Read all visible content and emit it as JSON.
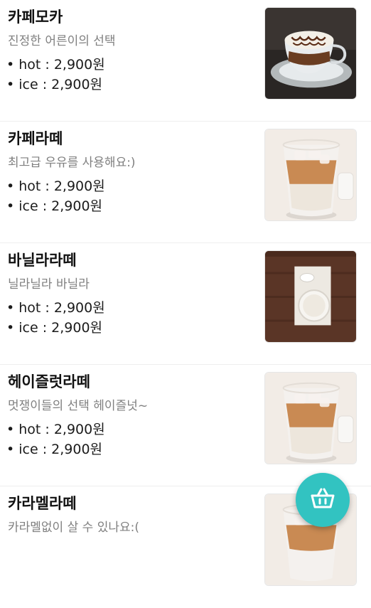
{
  "menu": {
    "items": [
      {
        "name": "카페모카",
        "description": "진정한 어른이의 선택",
        "hot_price": "• hot : 2,900원",
        "ice_price": "• ice : 2,900원",
        "image": "hot-mocha"
      },
      {
        "name": "카페라떼",
        "description": "최고급 우유를 사용해요:)",
        "hot_price": "• hot : 2,900원",
        "ice_price": "• ice : 2,900원",
        "image": "iced-latte"
      },
      {
        "name": "바닐라라떼",
        "description": "닐라닐라 바닐라",
        "hot_price": "• hot : 2,900원",
        "ice_price": "• ice : 2,900원",
        "image": "vanilla-latte-top"
      },
      {
        "name": "헤이즐럿라떼",
        "description": "멋쟁이들의 선택 헤이즐넛~",
        "hot_price": "• hot : 2,900원",
        "ice_price": "• ice : 2,900원",
        "image": "iced-latte"
      },
      {
        "name": "카라멜라떼",
        "description": "카라멜없이 살 수 있나요:(",
        "hot_price": "",
        "ice_price": "",
        "image": "iced-latte"
      }
    ]
  },
  "cart_button": {
    "icon": "basket-icon",
    "color": "#32c3c1"
  }
}
